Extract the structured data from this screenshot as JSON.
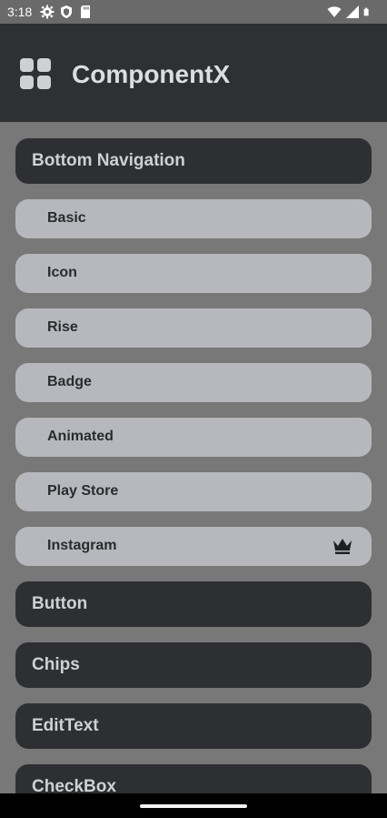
{
  "status_bar": {
    "time": "3:18",
    "left_icons": [
      "gear-icon",
      "shield-icon",
      "sd-card-icon"
    ],
    "right_icons": [
      "wifi-icon",
      "cell-signal-icon",
      "battery-icon"
    ]
  },
  "app_bar": {
    "icon": "dashboard-grid-icon",
    "title": "ComponentX"
  },
  "menu": {
    "bottom_navigation": {
      "label": "Bottom Navigation",
      "items": [
        {
          "label": "Basic"
        },
        {
          "label": "Icon"
        },
        {
          "label": "Rise"
        },
        {
          "label": "Badge"
        },
        {
          "label": "Animated"
        },
        {
          "label": "Play Store"
        },
        {
          "label": "Instagram",
          "badge_icon": "crown-icon"
        }
      ]
    },
    "sections": [
      {
        "label": "Button"
      },
      {
        "label": "Chips"
      },
      {
        "label": "EditText"
      },
      {
        "label": "CheckBox"
      }
    ]
  },
  "colors": {
    "background": "#787878",
    "app_bar": "#2f3033",
    "section": "#2e2f33",
    "item": "#b7b8bd"
  }
}
